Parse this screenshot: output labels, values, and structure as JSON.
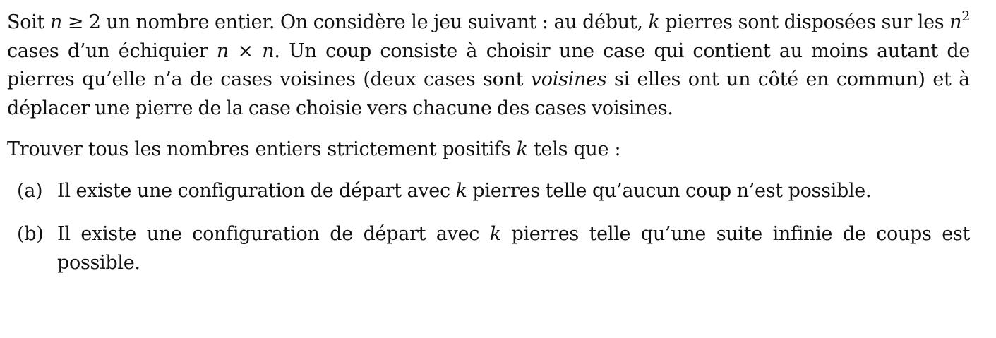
{
  "problem": {
    "intro": {
      "t1": "Soit ",
      "n1": "n",
      "t2": " ≥ 2 un nombre entier. On considère le jeu suivant : au début, ",
      "k1": "k",
      "t3": " pierres sont disposées sur les ",
      "n2": "n",
      "exp": "2",
      "t4": " cases d’un échiquier ",
      "n3": "n",
      "t5": " × ",
      "n4": "n",
      "t6": ". Un coup consiste à choisir une case qui contient au moins autant de pierres qu’elle n’a de cases voisines (deux cases sont ",
      "emph": "voisines",
      "t7": " si elles ont un côté en commun) et à déplacer une pierre de la case choisie vers chacune des cases voisines."
    },
    "question": {
      "t1": "Trouver tous les nombres entiers strictement positifs ",
      "k": "k",
      "t2": " tels que :"
    },
    "items": [
      {
        "label": "(a)",
        "t1": "Il existe une configuration de départ avec ",
        "k": "k",
        "t2": " pierres telle qu’aucun coup n’est possible."
      },
      {
        "label": "(b)",
        "t1": "Il existe une configuration de départ avec ",
        "k": "k",
        "t2": " pierres telle qu’une suite infinie de coups est possible."
      }
    ]
  }
}
